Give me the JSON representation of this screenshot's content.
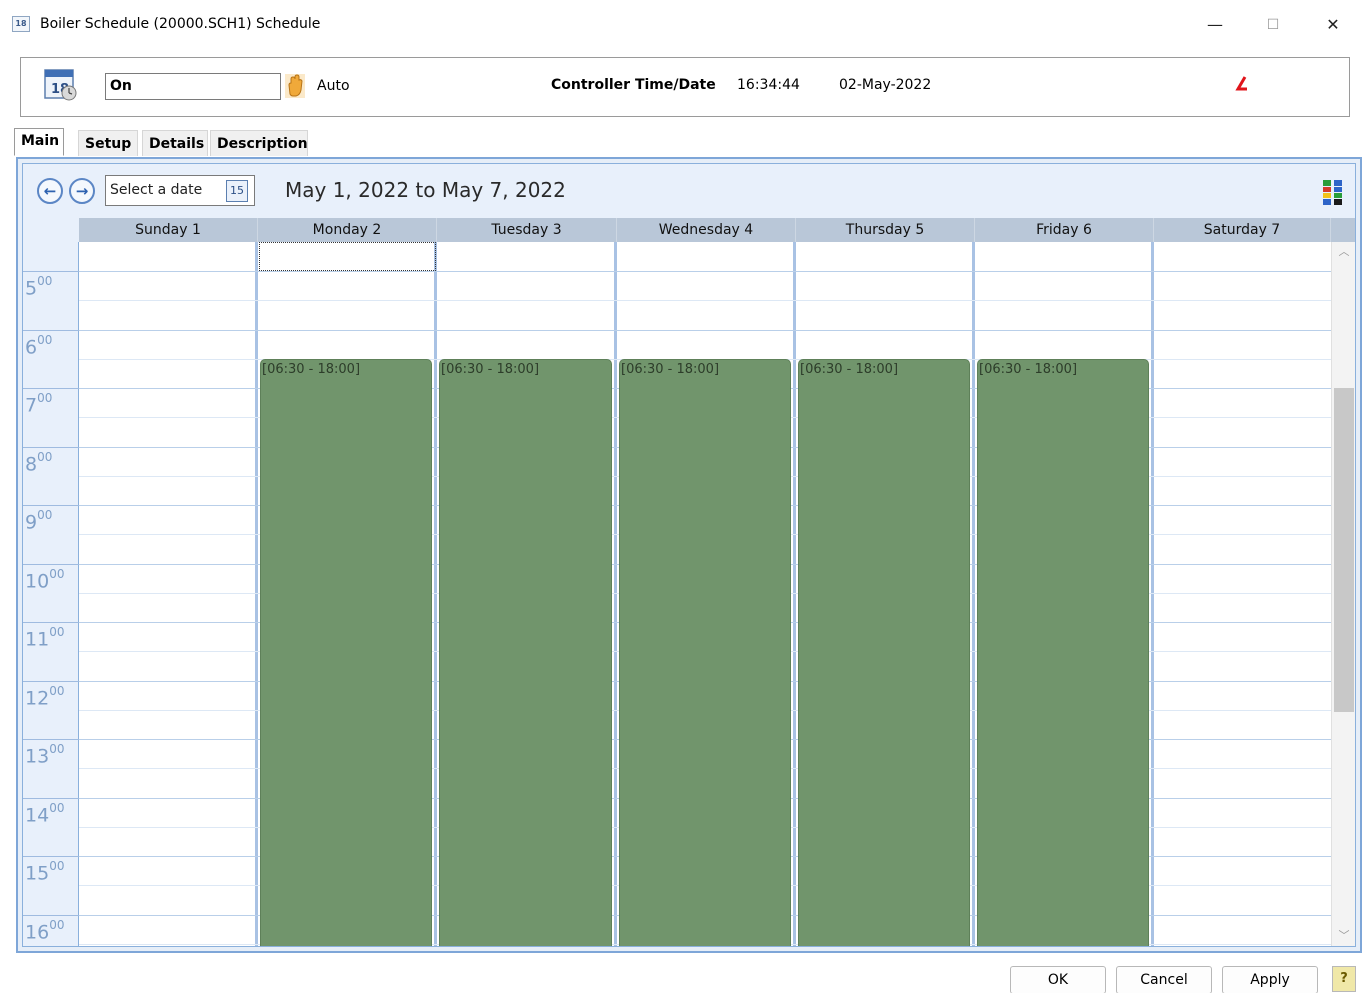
{
  "window": {
    "title": "Boiler Schedule  (20000.SCH1)  Schedule",
    "minimize_glyph": "—",
    "maximize_glyph": "☐",
    "close_glyph": "✕",
    "icon_text": "18"
  },
  "toolbar": {
    "mode_value": "On",
    "auto_label": "Auto",
    "controller_label": "Controller Time/Date",
    "controller_time": "16:34:44",
    "controller_date": "02-May-2022",
    "calendar_icon_text": "18"
  },
  "tabs": [
    "Main",
    "Setup",
    "Details",
    "Description"
  ],
  "calendar": {
    "nav_prev": "←",
    "nav_next": "→",
    "date_placeholder": "Select a date",
    "date_icon_text": "15",
    "range_title": "May 1, 2022 to May 7, 2022",
    "days": [
      "Sunday 1",
      "Monday 2",
      "Tuesday 3",
      "Wednesday 4",
      "Thursday 5",
      "Friday 6",
      "Saturday 7"
    ],
    "hours": [
      {
        "h": "5",
        "m": "00"
      },
      {
        "h": "6",
        "m": "00"
      },
      {
        "h": "7",
        "m": "00"
      },
      {
        "h": "8",
        "m": "00"
      },
      {
        "h": "9",
        "m": "00"
      },
      {
        "h": "10",
        "m": "00"
      },
      {
        "h": "11",
        "m": "00"
      },
      {
        "h": "12",
        "m": "00"
      },
      {
        "h": "13",
        "m": "00"
      },
      {
        "h": "14",
        "m": "00"
      },
      {
        "h": "15",
        "m": "00"
      },
      {
        "h": "16",
        "m": "00"
      }
    ],
    "events": [
      {
        "day": 1,
        "label": "[06:30 - 18:00]"
      },
      {
        "day": 2,
        "label": "[06:30 - 18:00]"
      },
      {
        "day": 3,
        "label": "[06:30 - 18:00]"
      },
      {
        "day": 4,
        "label": "[06:30 - 18:00]"
      },
      {
        "day": 5,
        "label": "[06:30 - 18:00]"
      }
    ],
    "event_color": "#71956c"
  },
  "footer": {
    "ok_label": "OK",
    "cancel_label": "Cancel",
    "apply_label": "Apply",
    "help_label": "?"
  }
}
